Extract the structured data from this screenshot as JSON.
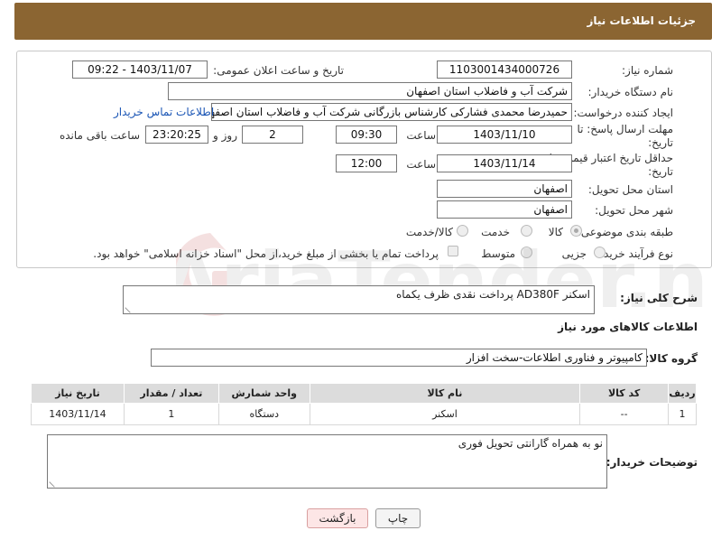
{
  "header": {
    "title": "جزئیات اطلاعات نیاز"
  },
  "fields": {
    "need_number_label": "شماره نیاز:",
    "need_number": "1103001434000726",
    "announce_label": "تاریخ و ساعت اعلان عمومی:",
    "announce_value": "1403/11/07 - 09:22",
    "buyer_label": "نام دستگاه خریدار:",
    "buyer_value": "شرکت آب و فاضلاب استان اصفهان",
    "creator_label": "ایجاد کننده درخواست:",
    "creator_value": "حمیدرضا محمدی فشارکی کارشناس بازرگانی شرکت آب و فاضلاب استان اصفهان",
    "contact_link": "اطلاعات تماس خریدار",
    "deadline_label_1": "مهلت ارسال پاسخ: تا",
    "deadline_label_2": "تاریخ:",
    "deadline_date": "1403/11/10",
    "time_label": "ساعت",
    "deadline_time": "09:30",
    "days_value": "2",
    "days_label": "روز و",
    "remaining_value": "23:20:25",
    "remaining_label": "ساعت باقی مانده",
    "validity_label_1": "حداقل تاریخ اعتبار قیمت: تا",
    "validity_label_2": "تاریخ:",
    "validity_date": "1403/11/14",
    "validity_time_label": "ساعت",
    "validity_time": "12:00",
    "province_label": "استان محل تحویل:",
    "province_value": "اصفهان",
    "city_label": "شهر محل تحویل:",
    "city_value": "اصفهان",
    "category_label": "طبقه بندی موضوعی:",
    "category_options": [
      "کالا",
      "خدمت",
      "کالا/خدمت"
    ],
    "process_label": "نوع فرآیند خرید :",
    "process_options": [
      "جزیی",
      "متوسط"
    ],
    "payment_note": "پرداخت تمام یا بخشی از مبلغ خرید،از محل \"اسناد خزانه اسلامی\" خواهد بود."
  },
  "description": {
    "label": "شرح کلی نیاز:",
    "value": "اسکنر AD380F  پرداخت نقدی ظرف یکماه"
  },
  "goods": {
    "section_title": "اطلاعات کالاهای مورد نیاز",
    "group_label": "گروه کالا:",
    "group_value": "کامپیوتر و فناوری اطلاعات-سخت افزار",
    "columns": [
      "ردیف",
      "کد کالا",
      "نام کالا",
      "واحد شمارش",
      "تعداد / مقدار",
      "تاریخ نیاز"
    ],
    "rows": [
      [
        "1",
        "--",
        "اسکنر",
        "دستگاه",
        "1",
        "1403/11/14"
      ]
    ]
  },
  "buyer_notes": {
    "label": "توضیحات خریدار:",
    "value": "نو به همراه گارانتی تحویل فوری"
  },
  "buttons": {
    "print": "چاپ",
    "back": "بازگشت"
  },
  "watermark": {
    "text": "AriaTender.net"
  }
}
